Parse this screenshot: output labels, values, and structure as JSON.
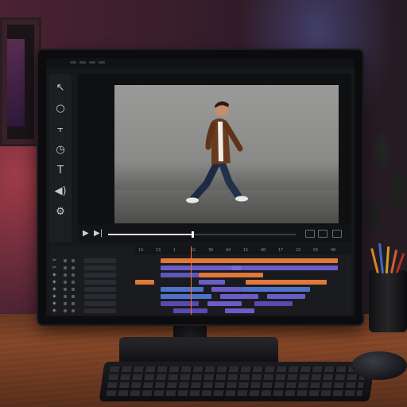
{
  "scene": {
    "description_free": true,
    "accent_orange": "#e0783a",
    "accent_purple": "#6c5cc8",
    "accent_blue": "#4e72c8"
  },
  "tools": [
    {
      "icon": "cursor-arrow-icon",
      "glyph": "↖"
    },
    {
      "icon": "circle-icon",
      "glyph": "○"
    },
    {
      "icon": "trim-icon",
      "glyph": "⫟"
    },
    {
      "icon": "clock-icon",
      "glyph": "◷"
    },
    {
      "icon": "text-tool-icon",
      "glyph": "T"
    },
    {
      "icon": "audio-icon",
      "glyph": "◀)"
    },
    {
      "icon": "gear-icon",
      "glyph": "⚙"
    }
  ],
  "transport": {
    "play": "▶",
    "next": "▶|",
    "progress": 0.45
  },
  "timeline": {
    "ruler_ticks": [
      "19",
      "13",
      "1",
      "22",
      "30",
      "44",
      "15",
      "40",
      "17",
      "23",
      "63",
      "48"
    ],
    "tracks": [
      {
        "icon": "✂",
        "clips": [
          {
            "color": "#e0783a",
            "start": 0.12,
            "end": 0.95
          }
        ]
      },
      {
        "icon": "✂",
        "clips": [
          {
            "color": "#6c5cc8",
            "start": 0.12,
            "end": 0.45
          },
          {
            "color": "#7a6ad4",
            "start": 0.45,
            "end": 0.5
          },
          {
            "color": "#6c5cc8",
            "start": 0.5,
            "end": 0.95
          }
        ]
      },
      {
        "icon": "◈",
        "clips": [
          {
            "color": "#5a5ab8",
            "start": 0.12,
            "end": 0.3
          },
          {
            "color": "#e0783a",
            "start": 0.3,
            "end": 0.6
          }
        ]
      },
      {
        "icon": "◈",
        "clips": [
          {
            "color": "#e0783a",
            "start": 0.0,
            "end": 0.09
          },
          {
            "color": "#6c5cc8",
            "start": 0.3,
            "end": 0.42
          },
          {
            "color": "#e0783a",
            "start": 0.52,
            "end": 0.9
          }
        ]
      },
      {
        "icon": "◈",
        "clips": [
          {
            "color": "#4e72c8",
            "start": 0.12,
            "end": 0.32
          },
          {
            "color": "#6c5cc8",
            "start": 0.36,
            "end": 0.5
          },
          {
            "color": "#4e72c8",
            "start": 0.5,
            "end": 0.82
          }
        ]
      },
      {
        "icon": "◈",
        "clips": [
          {
            "color": "#4e72c8",
            "start": 0.12,
            "end": 0.36
          },
          {
            "color": "#6c5cc8",
            "start": 0.4,
            "end": 0.58
          },
          {
            "color": "#6c5cc8",
            "start": 0.62,
            "end": 0.8
          }
        ]
      },
      {
        "icon": "◈",
        "clips": [
          {
            "color": "#5a4ab0",
            "start": 0.12,
            "end": 0.3
          },
          {
            "color": "#6c5cc8",
            "start": 0.34,
            "end": 0.5
          },
          {
            "color": "#5a4ab0",
            "start": 0.56,
            "end": 0.74
          }
        ]
      },
      {
        "icon": "◈",
        "clips": [
          {
            "color": "#5a4ab0",
            "start": 0.18,
            "end": 0.34
          },
          {
            "color": "#6c5cc8",
            "start": 0.42,
            "end": 0.56
          }
        ]
      }
    ],
    "playhead": 0.26
  }
}
